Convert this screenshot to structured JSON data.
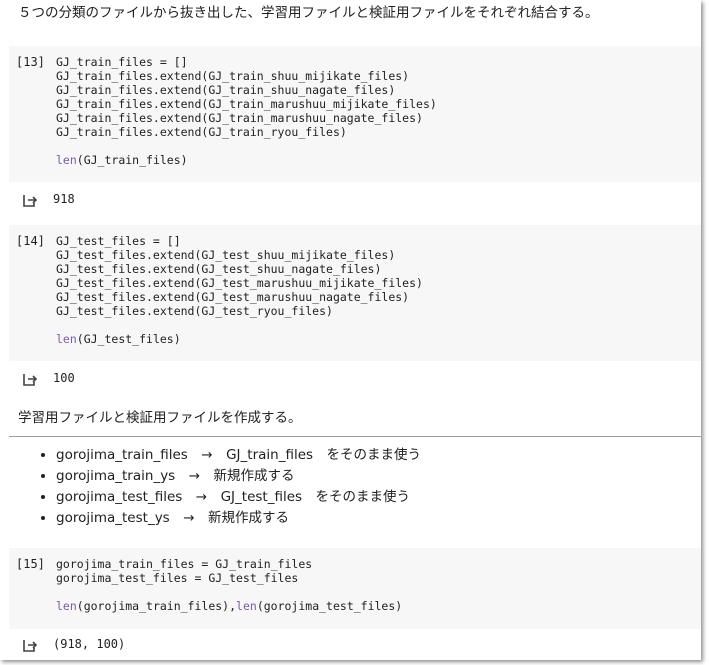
{
  "intro_text": "５つの分類のファイルから抜き出した、学習用ファイルと検証用ファイルをそれぞれ結合する。",
  "cells": [
    {
      "prompt": "[13]",
      "code_lines": [
        "GJ_train_files = []",
        "GJ_train_files.extend(GJ_train_shuu_mijikate_files)",
        "GJ_train_files.extend(GJ_train_shuu_nagate_files)",
        "GJ_train_files.extend(GJ_train_marushuu_mijikate_files)",
        "GJ_train_files.extend(GJ_train_marushuu_nagate_files)",
        "GJ_train_files.extend(GJ_train_ryou_files)",
        "",
        "len(GJ_train_files)"
      ],
      "output": "918"
    },
    {
      "prompt": "[14]",
      "code_lines": [
        "GJ_test_files = []",
        "GJ_test_files.extend(GJ_test_shuu_mijikate_files)",
        "GJ_test_files.extend(GJ_test_shuu_nagate_files)",
        "GJ_test_files.extend(GJ_test_marushuu_mijikate_files)",
        "GJ_test_files.extend(GJ_test_marushuu_nagate_files)",
        "GJ_test_files.extend(GJ_test_ryou_files)",
        "",
        "len(GJ_test_files)"
      ],
      "output": "100"
    },
    {
      "prompt": "[15]",
      "code_lines": [
        "gorojima_train_files = GJ_train_files",
        "gorojima_test_files = GJ_test_files",
        "",
        "len(gorojima_train_files),len(gorojima_test_files)"
      ],
      "output": "(918, 100)"
    }
  ],
  "section_text": "学習用ファイルと検証用ファイルを作成する。",
  "bullets": [
    "gorojima_train_files　→　GJ_train_files　をそのまま使う",
    "gorojima_train_ys　→　新規作成する",
    "gorojima_test_files　→　GJ_test_files　をそのまま使う",
    "gorojima_test_ys　→　新規作成する"
  ],
  "icons": {
    "output": "output-arrow-icon"
  },
  "colors": {
    "code_bg": "#f7f7f7",
    "keyword": "#795da3"
  }
}
